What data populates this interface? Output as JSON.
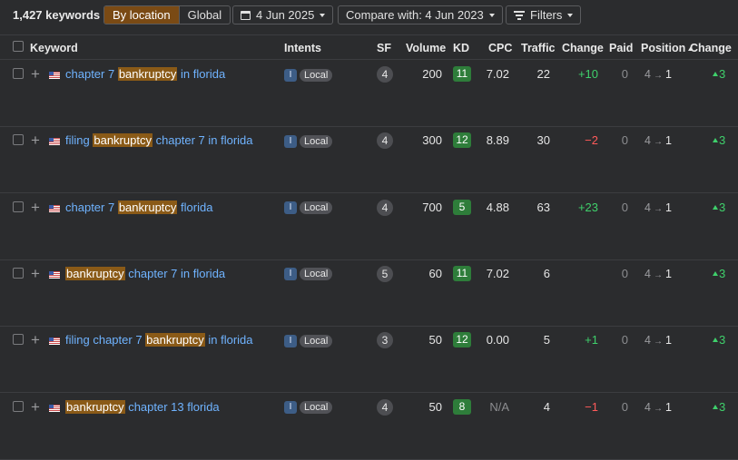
{
  "toolbar": {
    "keyword_count": "1,427 keywords",
    "by_location": "By location",
    "global": "Global",
    "date": "4 Jun 2025",
    "compare": "Compare with: 4 Jun 2023",
    "filters": "Filters"
  },
  "columns": {
    "keyword": "Keyword",
    "intents": "Intents",
    "sf": "SF",
    "volume": "Volume",
    "kd": "KD",
    "cpc": "CPC",
    "traffic": "Traffic",
    "change": "Change",
    "paid": "Paid",
    "position": "Position",
    "pos_change": "Change"
  },
  "colors": {
    "accent": "#7a4a14",
    "link": "#6fb3ff",
    "positive": "#3fd06b",
    "negative": "#ff5a5a",
    "kd_green": "#2e7d3a"
  },
  "rows": [
    {
      "pre": "chapter 7 ",
      "hl": "bankruptcy",
      "post": " in florida",
      "intent": "I",
      "tag": "Local",
      "sf": "4",
      "volume": "200",
      "kd": "11",
      "cpc": "7.02",
      "traffic": "22",
      "change": "+10",
      "change_dir": "up",
      "paid": "0",
      "pos_from": "4",
      "pos_to": "1",
      "pos_change": "3"
    },
    {
      "pre": "filing ",
      "hl": "bankruptcy",
      "post": " chapter 7 in florida",
      "intent": "I",
      "tag": "Local",
      "sf": "4",
      "volume": "300",
      "kd": "12",
      "cpc": "8.89",
      "traffic": "30",
      "change": "−2",
      "change_dir": "down",
      "paid": "0",
      "pos_from": "4",
      "pos_to": "1",
      "pos_change": "3"
    },
    {
      "pre": "chapter 7 ",
      "hl": "bankruptcy",
      "post": " florida",
      "intent": "I",
      "tag": "Local",
      "sf": "4",
      "volume": "700",
      "kd": "5",
      "cpc": "4.88",
      "traffic": "63",
      "change": "+23",
      "change_dir": "up",
      "paid": "0",
      "pos_from": "4",
      "pos_to": "1",
      "pos_change": "3"
    },
    {
      "pre": "",
      "hl": "bankruptcy",
      "post": " chapter 7 in florida",
      "intent": "I",
      "tag": "Local",
      "sf": "5",
      "volume": "60",
      "kd": "11",
      "cpc": "7.02",
      "traffic": "6",
      "change": "",
      "change_dir": "none",
      "paid": "0",
      "pos_from": "4",
      "pos_to": "1",
      "pos_change": "3"
    },
    {
      "pre": "filing chapter 7 ",
      "hl": "bankruptcy",
      "post": " in florida",
      "intent": "I",
      "tag": "Local",
      "sf": "3",
      "volume": "50",
      "kd": "12",
      "cpc": "0.00",
      "traffic": "5",
      "change": "+1",
      "change_dir": "up",
      "paid": "0",
      "pos_from": "4",
      "pos_to": "1",
      "pos_change": "3"
    },
    {
      "pre": "",
      "hl": "bankruptcy",
      "post": " chapter 13 florida",
      "intent": "I",
      "tag": "Local",
      "sf": "4",
      "volume": "50",
      "kd": "8",
      "cpc": "N/A",
      "traffic": "4",
      "change": "−1",
      "change_dir": "down",
      "paid": "0",
      "pos_from": "4",
      "pos_to": "1",
      "pos_change": "3"
    }
  ]
}
